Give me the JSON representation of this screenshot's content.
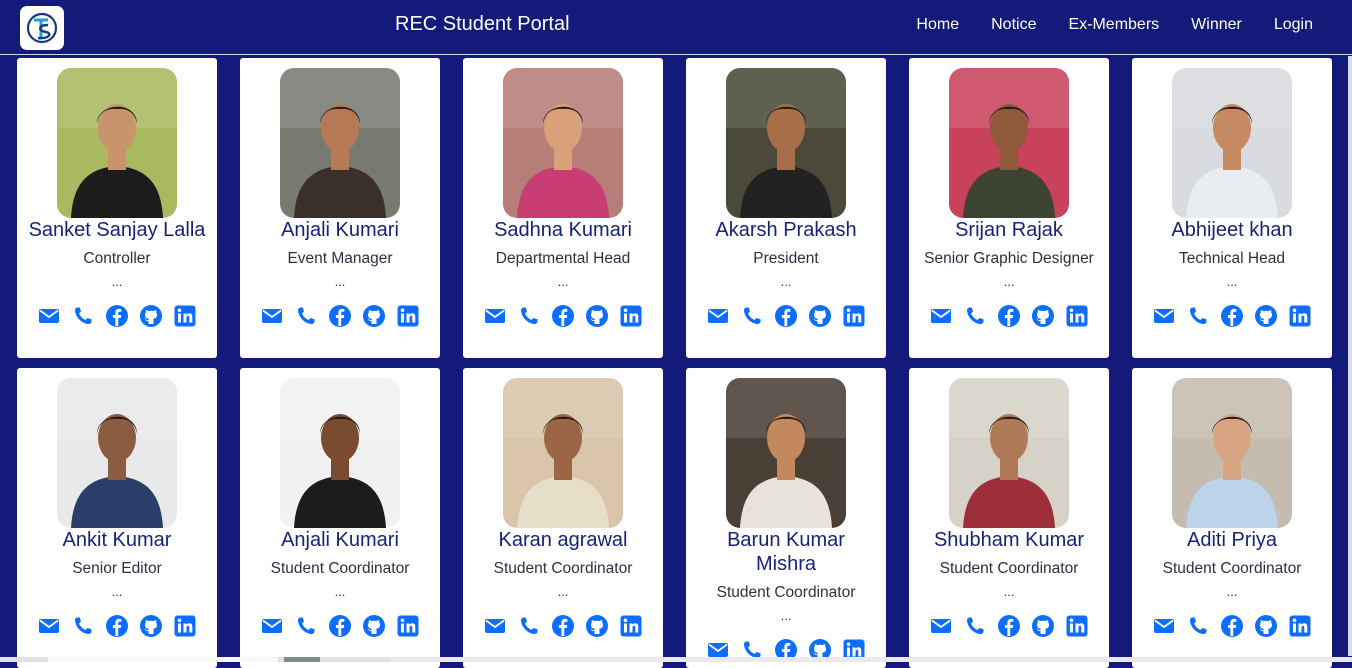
{
  "navbar": {
    "brand": "REC Student Portal",
    "links": [
      "Home",
      "Notice",
      "Ex-Members",
      "Winner",
      "Login"
    ]
  },
  "members": [
    {
      "name": "Sanket Sanjay Lalla",
      "role": "Controller",
      "dots": "..."
    },
    {
      "name": "Anjali Kumari",
      "role": "Event Manager",
      "dots": "..."
    },
    {
      "name": "Sadhna Kumari",
      "role": "Departmental Head",
      "dots": "..."
    },
    {
      "name": "Akarsh Prakash",
      "role": "President",
      "dots": "..."
    },
    {
      "name": "Srijan Rajak",
      "role": "Senior Graphic Designer",
      "dots": "..."
    },
    {
      "name": "Abhijeet khan",
      "role": "Technical Head",
      "dots": "..."
    },
    {
      "name": "Ankit Kumar",
      "role": "Senior Editor",
      "dots": "..."
    },
    {
      "name": "Anjali Kumari",
      "role": "Student Coordinator",
      "dots": "..."
    },
    {
      "name": "Karan agrawal",
      "role": "Student Coordinator",
      "dots": "..."
    },
    {
      "name": "Barun Kumar Mishra",
      "role": "Student Coordinator",
      "dots": "..."
    },
    {
      "name": "Shubham Kumar",
      "role": "Student Coordinator",
      "dots": "..."
    },
    {
      "name": "Aditi Priya",
      "role": "Student Coordinator",
      "dots": "..."
    }
  ],
  "social_icons": [
    "mail-icon",
    "phone-icon",
    "facebook-icon",
    "github-icon",
    "linkedin-icon"
  ],
  "colors": {
    "background": "#141a7a",
    "name_text": "#17237a",
    "icon_blue": "#0d6efd"
  }
}
